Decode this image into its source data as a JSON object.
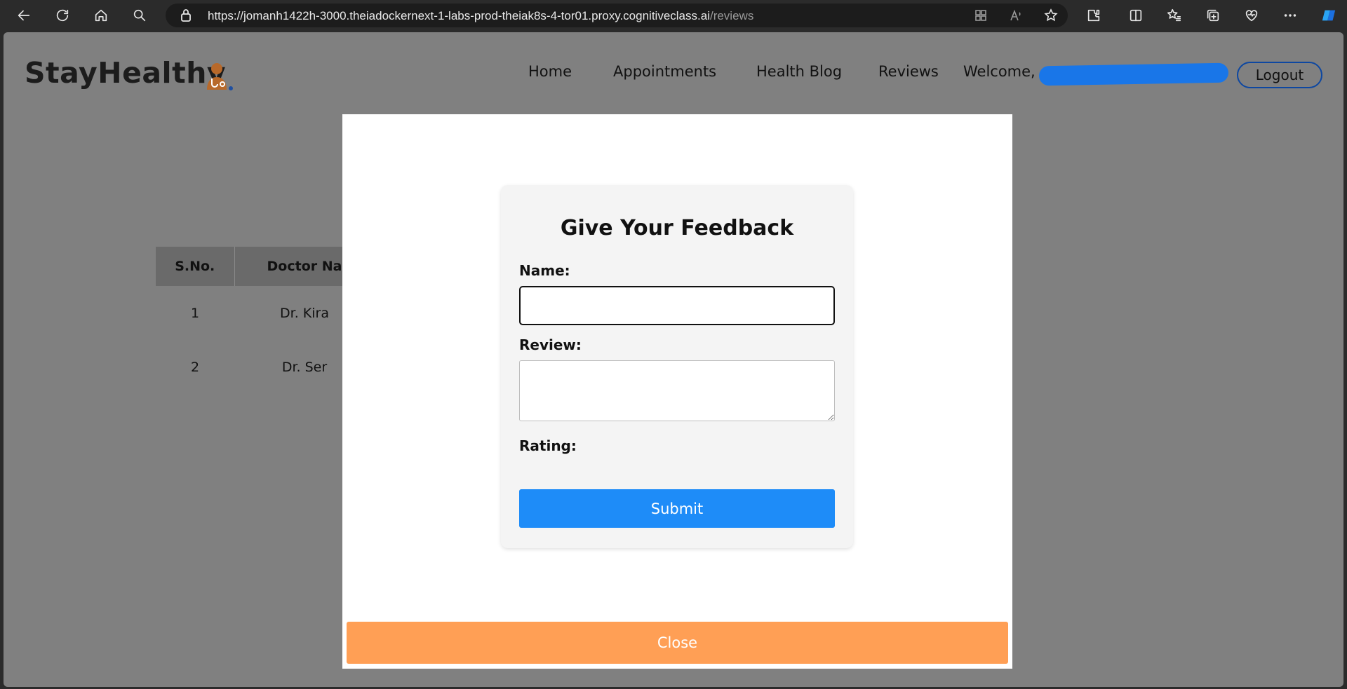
{
  "browser": {
    "url_main": "https://jomanh1422h-3000.theiadockernext-1-labs-prod-theiak8s-4-tor01.proxy.cognitiveclass.ai",
    "url_path": "/reviews"
  },
  "header": {
    "brand": "StayHealthy",
    "nav": {
      "home": "Home",
      "appointments": "Appointments",
      "blog": "Health Blog",
      "reviews": "Reviews",
      "welcome": "Welcome,"
    },
    "logout": "Logout"
  },
  "table": {
    "headers": [
      "S.No.",
      "Doctor Na"
    ],
    "rows": [
      [
        "1",
        "Dr. Kira"
      ],
      [
        "2",
        "Dr. Ser"
      ]
    ]
  },
  "modal": {
    "title": "Give Your Feedback",
    "name_label": "Name:",
    "name_value": "",
    "review_label": "Review:",
    "review_value": "",
    "rating_label": "Rating:",
    "submit": "Submit",
    "close": "Close"
  },
  "colors": {
    "accent_blue": "#1e8cf8",
    "close_orange": "#ff9f55",
    "overlay": "#808080"
  }
}
